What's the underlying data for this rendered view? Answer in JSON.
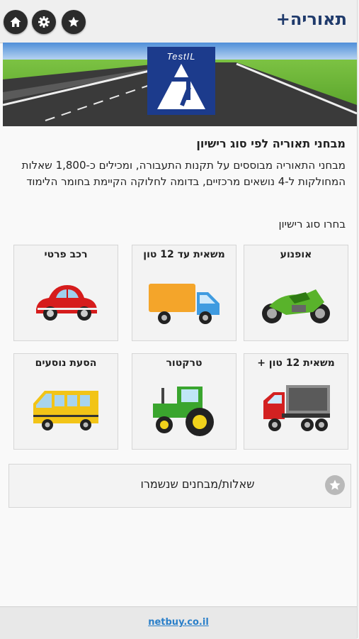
{
  "header": {
    "title": "תאוריה+",
    "buttons": [
      {
        "name": "home",
        "icon": "home-icon"
      },
      {
        "name": "settings",
        "icon": "gear-icon"
      },
      {
        "name": "favorites",
        "icon": "star-icon"
      }
    ]
  },
  "banner": {
    "brand": "TestIL",
    "letter": "ל"
  },
  "intro": {
    "title": "מבחני תאוריה לפי סוג רישיון",
    "description": "מבחני התאוריה מבוססים על תקנות התעבורה, ומכילים כ-1,800 שאלות המחולקות ל-4 נושאים מרכזיים, בדומה לחלוקה הקיימת בחומר הלימוד",
    "choose": "בחרו סוג רישיון"
  },
  "licenses": [
    {
      "label": "רכב פרטי",
      "icon": "car-icon"
    },
    {
      "label": "משאית עד 12 טון",
      "icon": "truck-icon"
    },
    {
      "label": "אופנוע",
      "icon": "motorcycle-icon"
    },
    {
      "label": "הסעת נוסעים",
      "icon": "bus-icon"
    },
    {
      "label": "טרקטור",
      "icon": "tractor-icon"
    },
    {
      "label": "משאית 12 טון +",
      "icon": "dump-truck-icon"
    }
  ],
  "saved": {
    "label": "שאלות/מבחנים שנשמרו",
    "icon": "star-icon"
  },
  "footer": {
    "link": "netbuy.co.il"
  },
  "colors": {
    "brand_blue": "#1c3b8c",
    "title_blue": "#1f3a6b",
    "link_blue": "#2a7fc9"
  }
}
